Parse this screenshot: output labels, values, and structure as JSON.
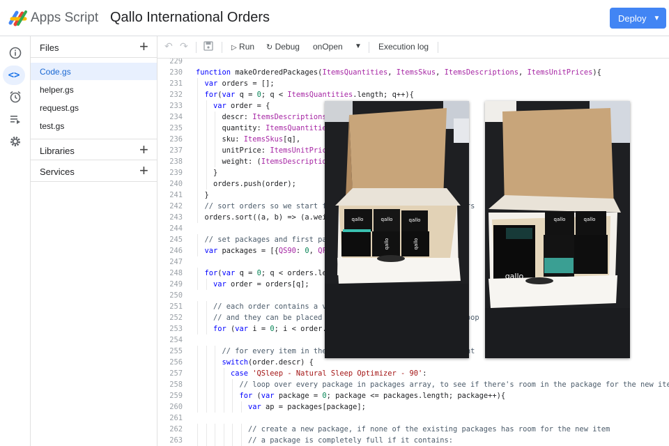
{
  "header": {
    "brand": "Apps Script",
    "project_title": "Qallo International Orders",
    "deploy_label": "Deploy"
  },
  "rail": {
    "icons": [
      "info-icon",
      "code-icon",
      "alarm-icon",
      "executions-icon",
      "settings-icon"
    ],
    "code_glyph": "<>"
  },
  "files_panel": {
    "files_label": "Files",
    "files": [
      "Code.gs",
      "helper.gs",
      "request.gs",
      "test.gs"
    ],
    "active_file": "Code.gs",
    "libraries_label": "Libraries",
    "services_label": "Services"
  },
  "toolbar": {
    "run_label": "Run",
    "debug_label": "Debug",
    "function_select": "onOpen",
    "execution_log_label": "Execution log"
  },
  "photos": {
    "box_brand": "qallo"
  },
  "editor": {
    "lines": [
      {
        "n": "229",
        "indent": 0,
        "t": [
          {
            "c": "",
            "v": ""
          }
        ]
      },
      {
        "n": "230",
        "indent": 0,
        "t": [
          {
            "c": "kw",
            "v": "function "
          },
          {
            "c": "",
            "v": "makeOrderedPackages("
          },
          {
            "c": "ty",
            "v": "ItemsQuantities"
          },
          {
            "c": "",
            "v": ", "
          },
          {
            "c": "ty",
            "v": "ItemsSkus"
          },
          {
            "c": "",
            "v": ", "
          },
          {
            "c": "ty",
            "v": "ItemsDescriptions"
          },
          {
            "c": "",
            "v": ", "
          },
          {
            "c": "ty",
            "v": "ItemsUnitPrices"
          },
          {
            "c": "",
            "v": "){"
          }
        ]
      },
      {
        "n": "231",
        "indent": 1,
        "t": [
          {
            "c": "kw",
            "v": "var "
          },
          {
            "c": "",
            "v": "orders = [];"
          }
        ]
      },
      {
        "n": "232",
        "indent": 1,
        "t": [
          {
            "c": "kw",
            "v": "for"
          },
          {
            "c": "",
            "v": "("
          },
          {
            "c": "kw",
            "v": "var "
          },
          {
            "c": "",
            "v": "q = "
          },
          {
            "c": "nm",
            "v": "0"
          },
          {
            "c": "",
            "v": "; q < "
          },
          {
            "c": "ty",
            "v": "ItemsQuantities"
          },
          {
            "c": "",
            "v": ".length; q++){"
          }
        ]
      },
      {
        "n": "233",
        "indent": 2,
        "t": [
          {
            "c": "kw",
            "v": "var "
          },
          {
            "c": "",
            "v": "order = {"
          }
        ]
      },
      {
        "n": "234",
        "indent": 3,
        "t": [
          {
            "c": "",
            "v": "descr: "
          },
          {
            "c": "ty",
            "v": "ItemsDescriptions"
          }
        ]
      },
      {
        "n": "235",
        "indent": 3,
        "t": [
          {
            "c": "",
            "v": "quantity: "
          },
          {
            "c": "ty",
            "v": "ItemsQuantitie"
          }
        ]
      },
      {
        "n": "236",
        "indent": 3,
        "t": [
          {
            "c": "",
            "v": "sku: "
          },
          {
            "c": "ty",
            "v": "ItemsSkus"
          },
          {
            "c": "",
            "v": "[q],"
          }
        ]
      },
      {
        "n": "237",
        "indent": 3,
        "t": [
          {
            "c": "",
            "v": "unitPrice: "
          },
          {
            "c": "ty",
            "v": "ItemsUnitPric"
          }
        ]
      },
      {
        "n": "238",
        "indent": 3,
        "t": [
          {
            "c": "",
            "v": "weight: ("
          },
          {
            "c": "ty",
            "v": "ItemsDescriptio"
          }
        ]
      },
      {
        "n": "239",
        "indent": 2,
        "t": [
          {
            "c": "",
            "v": "}"
          }
        ]
      },
      {
        "n": "240",
        "indent": 2,
        "t": [
          {
            "c": "",
            "v": "orders.push(order);"
          }
        ]
      },
      {
        "n": "241",
        "indent": 1,
        "t": [
          {
            "c": "",
            "v": "}"
          }
        ]
      },
      {
        "n": "242",
        "indent": 1,
        "t": [
          {
            "c": "cm",
            "v": "// sort orders so we start f                              firs"
          }
        ]
      },
      {
        "n": "243",
        "indent": 1,
        "t": [
          {
            "c": "",
            "v": "orders.sort((a, b) => (a.wei"
          }
        ]
      },
      {
        "n": "244",
        "indent": 0,
        "t": [
          {
            "c": "",
            "v": ""
          }
        ]
      },
      {
        "n": "245",
        "indent": 1,
        "t": [
          {
            "c": "cm",
            "v": "// set packages and first pa"
          }
        ]
      },
      {
        "n": "246",
        "indent": 1,
        "t": [
          {
            "c": "kw",
            "v": "var "
          },
          {
            "c": "",
            "v": "packages = [{"
          },
          {
            "c": "ty",
            "v": "QS90"
          },
          {
            "c": "",
            "v": ": "
          },
          {
            "c": "nm",
            "v": "0"
          },
          {
            "c": "",
            "v": ", "
          },
          {
            "c": "ty",
            "v": "QF"
          },
          {
            "c": "",
            "v": "                          ghtC"
          }
        ]
      },
      {
        "n": "247",
        "indent": 0,
        "t": [
          {
            "c": "",
            "v": ""
          }
        ]
      },
      {
        "n": "248",
        "indent": 1,
        "t": [
          {
            "c": "kw",
            "v": "for"
          },
          {
            "c": "",
            "v": "("
          },
          {
            "c": "kw",
            "v": "var "
          },
          {
            "c": "",
            "v": "q = "
          },
          {
            "c": "nm",
            "v": "0"
          },
          {
            "c": "",
            "v": "; q < orders.le"
          }
        ]
      },
      {
        "n": "249",
        "indent": 2,
        "t": [
          {
            "c": "kw",
            "v": "var "
          },
          {
            "c": "",
            "v": "order = orders[q];"
          }
        ]
      },
      {
        "n": "250",
        "indent": 0,
        "t": [
          {
            "c": "",
            "v": ""
          }
        ]
      },
      {
        "n": "251",
        "indent": 2,
        "t": [
          {
            "c": "cm",
            "v": "// each order contains a v"
          }
        ]
      },
      {
        "n": "252",
        "indent": 2,
        "t": [
          {
            "c": "cm",
            "v": "// and they can be placed                                 oop"
          }
        ]
      },
      {
        "n": "253",
        "indent": 2,
        "t": [
          {
            "c": "kw",
            "v": "for "
          },
          {
            "c": "",
            "v": "("
          },
          {
            "c": "kw",
            "v": "var "
          },
          {
            "c": "",
            "v": "i = "
          },
          {
            "c": "nm",
            "v": "0"
          },
          {
            "c": "",
            "v": "; i < order."
          }
        ]
      },
      {
        "n": "254",
        "indent": 0,
        "t": [
          {
            "c": "",
            "v": ""
          }
        ]
      },
      {
        "n": "255",
        "indent": 3,
        "t": [
          {
            "c": "cm",
            "v": "// for every item in the                               ght"
          }
        ]
      },
      {
        "n": "256",
        "indent": 3,
        "t": [
          {
            "c": "kw",
            "v": "switch"
          },
          {
            "c": "",
            "v": "(order.descr) {"
          }
        ]
      },
      {
        "n": "257",
        "indent": 4,
        "t": [
          {
            "c": "kw",
            "v": "case "
          },
          {
            "c": "st",
            "v": "'QSleep - Natural Sleep Optimizer - 90'"
          },
          {
            "c": "",
            "v": ":"
          }
        ]
      },
      {
        "n": "258",
        "indent": 5,
        "t": [
          {
            "c": "cm",
            "v": "// loop over every package in packages array, to see if there's room in the package for the new item"
          }
        ]
      },
      {
        "n": "259",
        "indent": 5,
        "t": [
          {
            "c": "kw",
            "v": "for "
          },
          {
            "c": "",
            "v": "("
          },
          {
            "c": "kw",
            "v": "var "
          },
          {
            "c": "",
            "v": "package = "
          },
          {
            "c": "nm",
            "v": "0"
          },
          {
            "c": "",
            "v": "; package <= packages.length; package++){"
          }
        ]
      },
      {
        "n": "260",
        "indent": 6,
        "t": [
          {
            "c": "kw",
            "v": "var "
          },
          {
            "c": "",
            "v": "ap = packages[package];"
          }
        ]
      },
      {
        "n": "261",
        "indent": 0,
        "t": [
          {
            "c": "",
            "v": ""
          }
        ]
      },
      {
        "n": "262",
        "indent": 6,
        "t": [
          {
            "c": "cm",
            "v": "// create a new package, if none of the existing packages has room for the new item"
          }
        ]
      },
      {
        "n": "263",
        "indent": 6,
        "t": [
          {
            "c": "cm",
            "v": "// a package is completely full if it contains:"
          }
        ]
      }
    ]
  }
}
